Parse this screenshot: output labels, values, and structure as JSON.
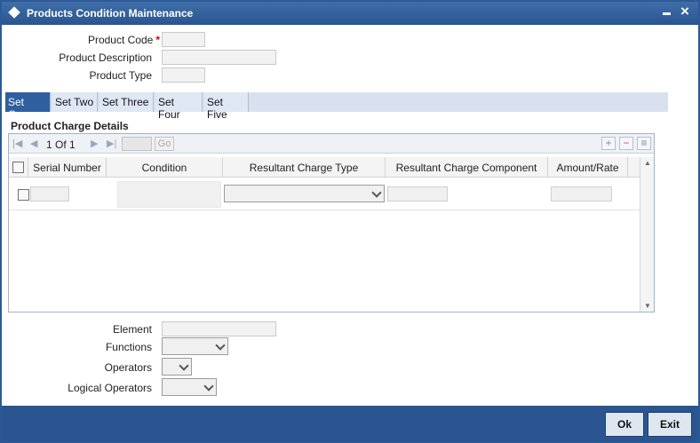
{
  "window": {
    "title": "Products Condition Maintenance",
    "close_glyph": "×",
    "colors": {
      "titlebar": "#2a5590",
      "active_tab": "#2f5f9e",
      "required": "#cc0000"
    }
  },
  "form": {
    "product_code_label": "Product Code",
    "required_mark": "*",
    "product_description_label": "Product Description",
    "product_type_label": "Product Type",
    "product_code_value": "",
    "product_description_value": "",
    "product_type_value": ""
  },
  "tabs": [
    {
      "label": "Set One",
      "active": true
    },
    {
      "label": "Set Two",
      "active": false
    },
    {
      "label": "Set Three",
      "active": false
    },
    {
      "label": "Set Four",
      "active": false
    },
    {
      "label": "Set Five",
      "active": false
    }
  ],
  "grid": {
    "title": "Product Charge Details",
    "pager": {
      "current": "1",
      "of_label": "Of",
      "total": "1",
      "go_label": "Go"
    },
    "icons": {
      "first": "first-page-icon",
      "prev": "prev-page-icon",
      "next": "next-page-icon",
      "last": "last-page-icon",
      "add": "plus-icon",
      "delete": "minus-icon",
      "view": "list-icon"
    },
    "columns": [
      "Serial Number",
      "Condition",
      "Resultant Charge Type",
      "Resultant Charge Component",
      "Amount/Rate"
    ],
    "rows": [
      {
        "serial_number": "",
        "condition": "",
        "charge_type": "",
        "charge_component": "",
        "amount_rate": ""
      }
    ]
  },
  "builder": {
    "element_label": "Element",
    "functions_label": "Functions",
    "operators_label": "Operators",
    "logical_operators_label": "Logical Operators",
    "element_value": "",
    "functions_value": "",
    "operators_value": "",
    "logical_operators_value": ""
  },
  "footer": {
    "ok_label": "Ok",
    "exit_label": "Exit"
  }
}
